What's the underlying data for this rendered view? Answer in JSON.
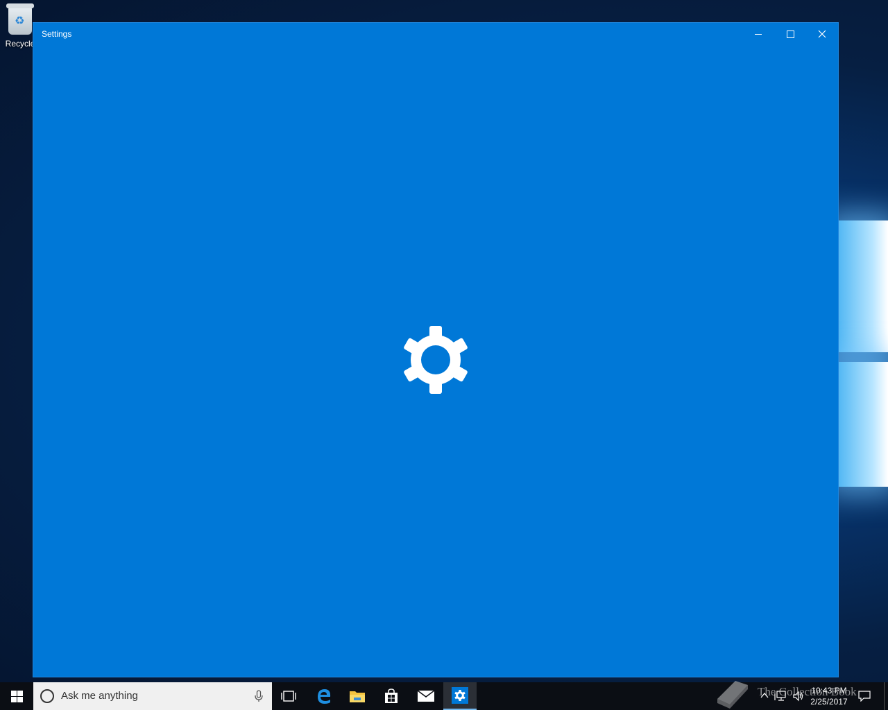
{
  "desktop": {
    "icons": [
      {
        "label": "Recycle",
        "icon": "recycle-bin-icon"
      }
    ],
    "watermark": "The Collection Book"
  },
  "window": {
    "title": "Settings",
    "accent_color": "#0078d7",
    "controls": {
      "minimize": "minimize-icon",
      "maximize": "maximize-icon",
      "close": "close-icon"
    },
    "loading_icon": "gear-icon"
  },
  "taskbar": {
    "search": {
      "placeholder": "Ask me anything"
    },
    "pinned": [
      {
        "name": "task-view",
        "icon": "task-view-icon"
      },
      {
        "name": "edge",
        "icon": "edge-icon"
      },
      {
        "name": "file-explorer",
        "icon": "folder-icon"
      },
      {
        "name": "store",
        "icon": "store-icon"
      },
      {
        "name": "mail",
        "icon": "mail-icon"
      },
      {
        "name": "settings",
        "icon": "gear-icon",
        "active": true
      }
    ],
    "clock": {
      "time": "10:43 PM",
      "date": "2/25/2017"
    }
  }
}
